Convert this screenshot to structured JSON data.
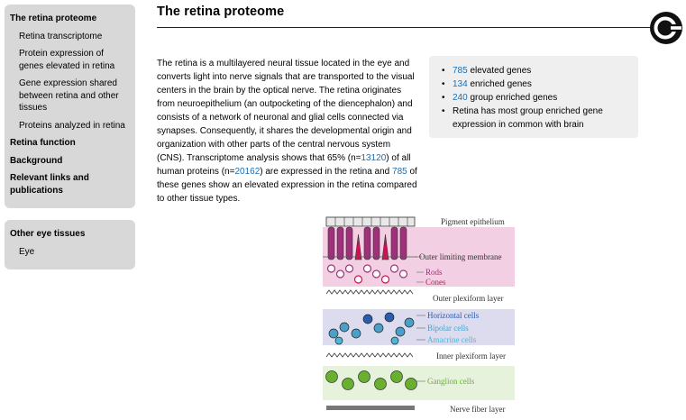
{
  "sidebar": {
    "title": "The retina proteome",
    "sub_items": [
      {
        "label": "Retina transcriptome"
      },
      {
        "label": "Protein expression of genes elevated in retina"
      },
      {
        "label": "Gene expression shared between retina and other tissues"
      },
      {
        "label": "Proteins analyzed in retina"
      }
    ],
    "sections": [
      {
        "label": "Retina function"
      },
      {
        "label": "Background"
      },
      {
        "label": "Relevant links and publications"
      }
    ]
  },
  "other_tissues": {
    "title": "Other eye tissues",
    "items": [
      {
        "label": "Eye"
      }
    ]
  },
  "page": {
    "title": "The retina proteome",
    "logo_icon": "brain-atlas-logo-icon"
  },
  "intro": {
    "p1": "The retina is a multilayered neural tissue located in the eye and converts light into nerve signals that are transported to the visual centers in the brain by the optical nerve. The retina originates from neuroepithelium (an outpocketing of the diencephalon) and consists of a network of neuronal and glial cells connected via synapses. Consequently, it shares the developmental origin and organization with other parts of the central nervous system (CNS). Transcriptome analysis shows that 65% (n=",
    "link1": "13120",
    "p2": ") of all human proteins (n=",
    "link2": "20162",
    "p3": ") are expressed in the retina and ",
    "link3": "785",
    "p4": " of these genes show an elevated expression in the retina compared to other tissue types."
  },
  "summary": {
    "elevated": {
      "count": "785",
      "text": " elevated genes"
    },
    "enriched": {
      "count": "134",
      "text": " enriched genes"
    },
    "group": {
      "count": "240",
      "text": " group enriched genes"
    },
    "note": "Retina has most group enriched gene expression in common with brain"
  },
  "figure": {
    "labels": {
      "pigment": "Pigment epithelium",
      "olm": "Outer limiting membrane",
      "rods": "Rods",
      "cones": "Cones",
      "opl": "Outer plexiform layer",
      "horizontal": "Horizontal cells",
      "bipolar": "Bipolar cells",
      "amacrine": "Amacrine cells",
      "ipl": "Inner plexiform layer",
      "ganglion": "Ganglion cells",
      "nfl": "Nerve fiber layer"
    },
    "colors": {
      "pink_band": "#f3cfe3",
      "blue_band": "#dcdcee",
      "green_band": "#e6f2dc",
      "rods": "#a0307a",
      "cones": "#d01050",
      "horizontal": "#2a5db0",
      "bipolar": "#4aa0c8",
      "amacrine": "#4ab8d8",
      "ganglion": "#6ab030"
    }
  }
}
